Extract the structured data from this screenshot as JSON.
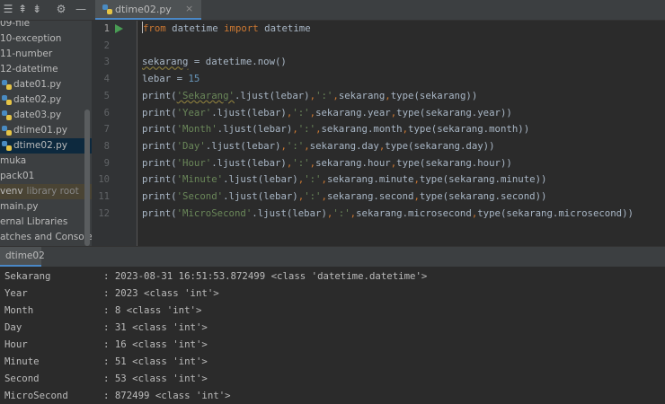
{
  "editor_tab": {
    "filename": "dtime02.py",
    "close": "×"
  },
  "sidebar": {
    "items": [
      {
        "label": "09-file"
      },
      {
        "label": "10-exception"
      },
      {
        "label": "11-number"
      },
      {
        "label": "12-datetime"
      },
      {
        "label": "date01.py"
      },
      {
        "label": "date02.py"
      },
      {
        "label": "date03.py"
      },
      {
        "label": "dtime01.py"
      },
      {
        "label": "dtime02.py"
      },
      {
        "label": "muka"
      },
      {
        "label": "pack01"
      },
      {
        "label": "venv",
        "extra": "library root"
      },
      {
        "label": "main.py"
      },
      {
        "label": "ernal Libraries"
      },
      {
        "label": "atches and Consoles"
      }
    ]
  },
  "line_numbers": [
    "1",
    "2",
    "3",
    "4",
    "5",
    "6",
    "7",
    "8",
    "9",
    "10",
    "11",
    "12"
  ],
  "code": {
    "l1": {
      "kw1": "from",
      "t1": " datetime ",
      "kw2": "import",
      "t2": " datetime"
    },
    "l3": {
      "var": "sekarang",
      "rest": " = datetime.now()"
    },
    "l4": {
      "var": "lebar",
      "eq": " = ",
      "num": "15"
    },
    "l5": {
      "a": "print(",
      "s": "'Sekarang'",
      "b": ".ljust(lebar)",
      "c": ",",
      "s2": "':'",
      "d": ",",
      "e": "sekarang",
      "f": ",",
      "g": "type(sekarang))"
    },
    "l6": {
      "a": "print(",
      "s": "'Year'",
      "b": ".ljust(lebar)",
      "c": ",",
      "s2": "':'",
      "d": ",",
      "e": "sekarang.year",
      "f": ",",
      "g": "type(sekarang.year))"
    },
    "l7": {
      "a": "print(",
      "s": "'Month'",
      "b": ".ljust(lebar)",
      "c": ",",
      "s2": "':'",
      "d": ",",
      "e": "sekarang.month",
      "f": ",",
      "g": "type(sekarang.month))"
    },
    "l8": {
      "a": "print(",
      "s": "'Day'",
      "b": ".ljust(lebar)",
      "c": ",",
      "s2": "':'",
      "d": ",",
      "e": "sekarang.day",
      "f": ",",
      "g": "type(sekarang.day))"
    },
    "l9": {
      "a": "print(",
      "s": "'Hour'",
      "b": ".ljust(lebar)",
      "c": ",",
      "s2": "':'",
      "d": ",",
      "e": "sekarang.hour",
      "f": ",",
      "g": "type(sekarang.hour))"
    },
    "l10": {
      "a": "print(",
      "s": "'Minute'",
      "b": ".ljust(lebar)",
      "c": ",",
      "s2": "':'",
      "d": ",",
      "e": "sekarang.minute",
      "f": ",",
      "g": "type(sekarang.minute))"
    },
    "l11": {
      "a": "print(",
      "s": "'Second'",
      "b": ".ljust(lebar)",
      "c": ",",
      "s2": "':'",
      "d": ",",
      "e": "sekarang.second",
      "f": ",",
      "g": "type(sekarang.second))"
    },
    "l12": {
      "a": "print(",
      "s": "'MicroSecond'",
      "b": ".ljust(lebar)",
      "c": ",",
      "s2": "':'",
      "d": ",",
      "e": "sekarang.microsecond",
      "f": ",",
      "g": "type(sekarang.microsecond))"
    }
  },
  "run_panel": {
    "tab_label": "dtime02"
  },
  "output": [
    {
      "label": "Sekarang",
      "value": ": 2023-08-31 16:51:53.872499 <class 'datetime.datetime'>"
    },
    {
      "label": "Year",
      "value": ": 2023 <class 'int'>"
    },
    {
      "label": "Month",
      "value": ": 8 <class 'int'>"
    },
    {
      "label": "Day",
      "value": ": 31 <class 'int'>"
    },
    {
      "label": "Hour",
      "value": ": 16 <class 'int'>"
    },
    {
      "label": "Minute",
      "value": ": 51 <class 'int'>"
    },
    {
      "label": "Second",
      "value": ": 53 <class 'int'>"
    },
    {
      "label": "MicroSecond",
      "value": ": 872499 <class 'int'>"
    }
  ],
  "icons": {
    "toolbar": [
      "collapse-all-icon",
      "expand-all-icon",
      "settings-gear-icon",
      "hide-icon"
    ],
    "run": "run-arrow-icon"
  },
  "colors": {
    "keyword": "#cc7832",
    "string": "#6a8759",
    "number": "#6897bb",
    "run_arrow": "#499c54",
    "selection": "#0d293e"
  }
}
